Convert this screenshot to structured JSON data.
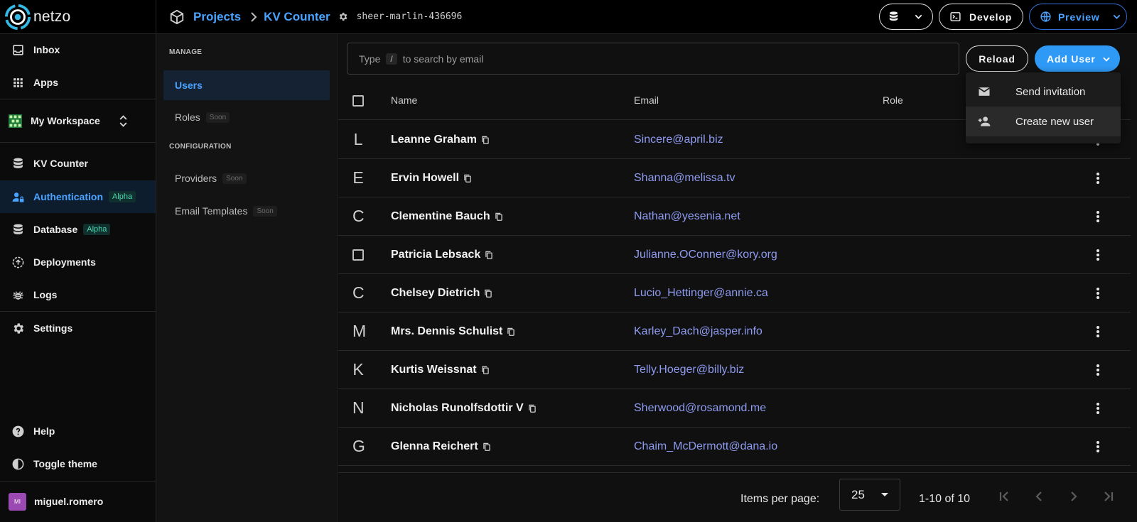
{
  "app": {
    "name": "netzo",
    "accent": "#2f9af6",
    "link": "#4aa3ff"
  },
  "breadcrumb": {
    "projects": "Projects",
    "project": "KV Counter",
    "project_id": "sheer-marlin-436696"
  },
  "topbar": {
    "develop_label": "Develop",
    "preview_label": "Preview",
    "db_icon": "database-icon"
  },
  "sidebar": {
    "inbox": "Inbox",
    "apps": "Apps",
    "workspace": "My Workspace",
    "project": "KV Counter",
    "authentication": "Authentication",
    "authentication_badge": "Alpha",
    "database": "Database",
    "database_badge": "Alpha",
    "deployments": "Deployments",
    "logs": "Logs",
    "settings": "Settings",
    "help": "Help",
    "toggle_theme": "Toggle theme",
    "user": {
      "initials": "MI",
      "name": "miguel.romero"
    }
  },
  "subnav": {
    "manage_title": "MANAGE",
    "users": "Users",
    "roles": "Roles",
    "roles_badge": "Soon",
    "config_title": "CONFIGURATION",
    "providers": "Providers",
    "providers_badge": "Soon",
    "email_templates": "Email Templates",
    "email_templates_badge": "Soon"
  },
  "search": {
    "prefix": "Type",
    "key": "/",
    "suffix": "to search by email"
  },
  "toolbar": {
    "reload_label": "Reload",
    "add_user_label": "Add User"
  },
  "add_user_menu": [
    {
      "label": "Send invitation",
      "icon": "mail-icon"
    },
    {
      "label": "Create new user",
      "icon": "person-add-icon"
    }
  ],
  "table": {
    "columns": {
      "name": "Name",
      "email": "Email",
      "role": "Role"
    },
    "rows": [
      {
        "initial": "L",
        "name": "Leanne Graham",
        "email": "Sincere@april.biz"
      },
      {
        "initial": "E",
        "name": "Ervin Howell",
        "email": "Shanna@melissa.tv"
      },
      {
        "initial": "C",
        "name": "Clementine Bauch",
        "email": "Nathan@yesenia.net"
      },
      {
        "initial": "",
        "name": "Patricia Lebsack",
        "email": "Julianne.OConner@kory.org",
        "checkbox": true
      },
      {
        "initial": "C",
        "name": "Chelsey Dietrich",
        "email": "Lucio_Hettinger@annie.ca"
      },
      {
        "initial": "M",
        "name": "Mrs. Dennis Schulist",
        "email": "Karley_Dach@jasper.info"
      },
      {
        "initial": "K",
        "name": "Kurtis Weissnat",
        "email": "Telly.Hoeger@billy.biz"
      },
      {
        "initial": "N",
        "name": "Nicholas Runolfsdottir V",
        "email": "Sherwood@rosamond.me"
      },
      {
        "initial": "G",
        "name": "Glenna Reichert",
        "email": "Chaim_McDermott@dana.io"
      }
    ]
  },
  "pagination": {
    "items_per_page_label": "Items per page:",
    "items_per_page": "25",
    "range": "1-10 of 10"
  }
}
